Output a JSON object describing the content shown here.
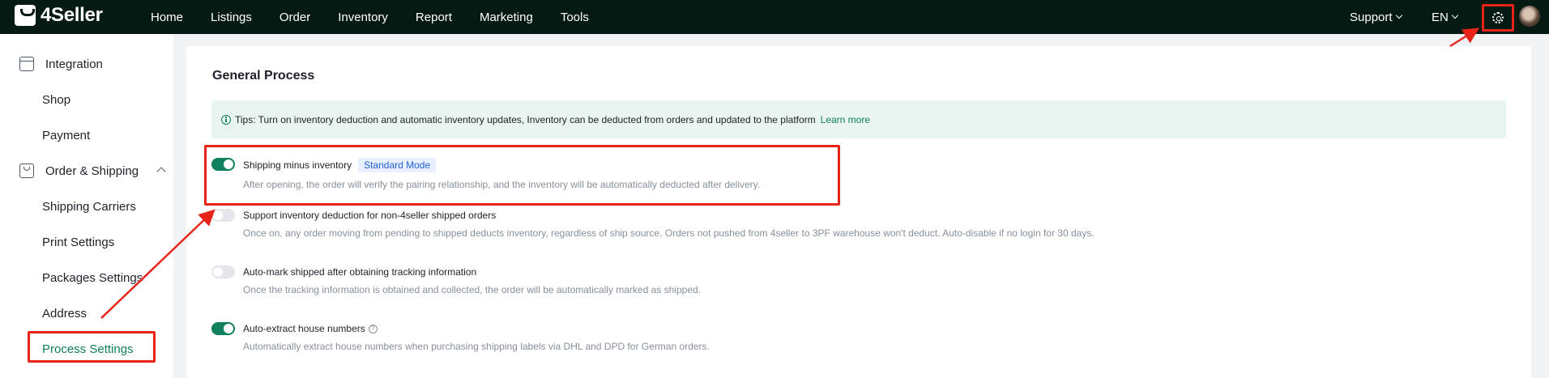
{
  "topbar": {
    "brand": "4Seller",
    "nav": [
      "Home",
      "Listings",
      "Order",
      "Inventory",
      "Report",
      "Marketing",
      "Tools"
    ],
    "support_label": "Support",
    "language_label": "EN"
  },
  "sidebar": {
    "items": [
      {
        "label": "Integration",
        "type": "group",
        "icon": "integration-icon"
      },
      {
        "label": "Shop",
        "type": "sub"
      },
      {
        "label": "Payment",
        "type": "sub"
      },
      {
        "label": "Order & Shipping",
        "type": "group",
        "icon": "order-icon",
        "expanded": true
      },
      {
        "label": "Shipping Carriers",
        "type": "sub"
      },
      {
        "label": "Print Settings",
        "type": "sub"
      },
      {
        "label": "Packages Settings",
        "type": "sub"
      },
      {
        "label": "Address",
        "type": "sub"
      },
      {
        "label": "Process Settings",
        "type": "sub",
        "active": true
      }
    ]
  },
  "main": {
    "title": "General Process",
    "tips": {
      "text": "Tips: Turn on inventory deduction and automatic inventory updates, Inventory can be deducted from orders and updated to the platform",
      "link": "Learn more"
    },
    "settings": [
      {
        "label": "Shipping minus inventory",
        "tag": "Standard Mode",
        "enabled": true,
        "description": "After opening, the order will verify the pairing relationship, and the inventory will be automatically deducted after delivery."
      },
      {
        "label": "Support inventory deduction for non-4seller shipped orders",
        "enabled": false,
        "description": "Once on, any order moving from pending to shipped deducts inventory, regardless of ship source. Orders not pushed from 4seller to 3PF warehouse won't deduct. Auto-disable if no login for 30 days."
      },
      {
        "label": "Auto-mark shipped after obtaining tracking information",
        "enabled": false,
        "description": "Once the tracking information is obtained and collected, the order will be automatically marked as shipped."
      },
      {
        "label": "Auto-extract house numbers",
        "enabled": true,
        "help_icon": "?",
        "description": "Automatically extract house numbers when purchasing shipping labels via DHL and DPD for German orders."
      }
    ]
  },
  "colors": {
    "topbar": "#061a14",
    "accent": "#0f7f5e",
    "annotation": "#e8231a"
  }
}
